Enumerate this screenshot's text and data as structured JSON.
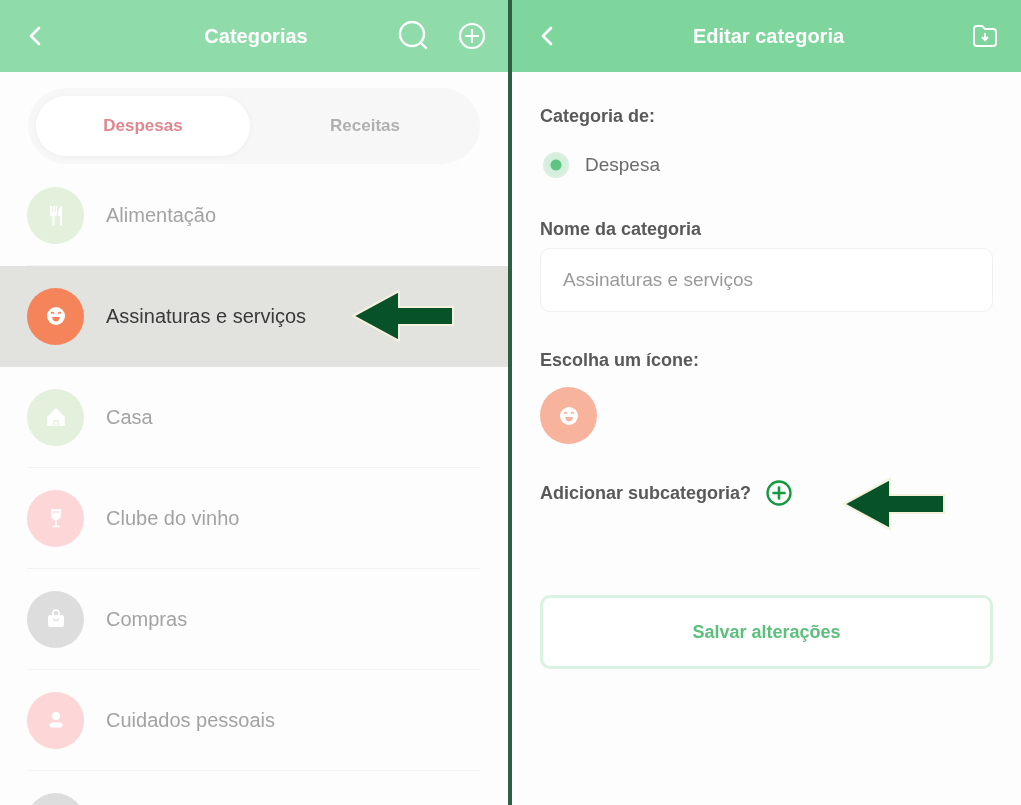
{
  "categories_screen": {
    "header": {
      "title": "Categorias"
    },
    "tabs": [
      {
        "label": "Despesas",
        "selected": true
      },
      {
        "label": "Receitas",
        "selected": false
      }
    ],
    "categories": [
      {
        "label": "Alimentação",
        "color": "#e3f1dc",
        "selected": false
      },
      {
        "label": "Assinaturas e serviços",
        "color": "#f6845a",
        "selected": true
      },
      {
        "label": "Casa",
        "color": "#e3f1dc",
        "selected": false
      },
      {
        "label": "Clube do vinho",
        "color": "#fdd6d7",
        "selected": false
      },
      {
        "label": "Compras",
        "color": "#dddddd",
        "selected": false
      },
      {
        "label": "Cuidados pessoais",
        "color": "#fdd6d7",
        "selected": false
      },
      {
        "color": "#dddddd",
        "selected": false
      }
    ]
  },
  "edit_screen": {
    "header": {
      "title": "Editar categoria"
    },
    "type_label": "Categoria de:",
    "type_options": [
      {
        "label": "Despesa",
        "selected": true
      }
    ],
    "name_label": "Nome da categoria",
    "name_field": {
      "value": "Assinaturas e serviços"
    },
    "icon_label": "Escolha um ícone:",
    "subcategory_label": "Adicionar subcategoria?",
    "save_button": "Salvar alterações"
  }
}
